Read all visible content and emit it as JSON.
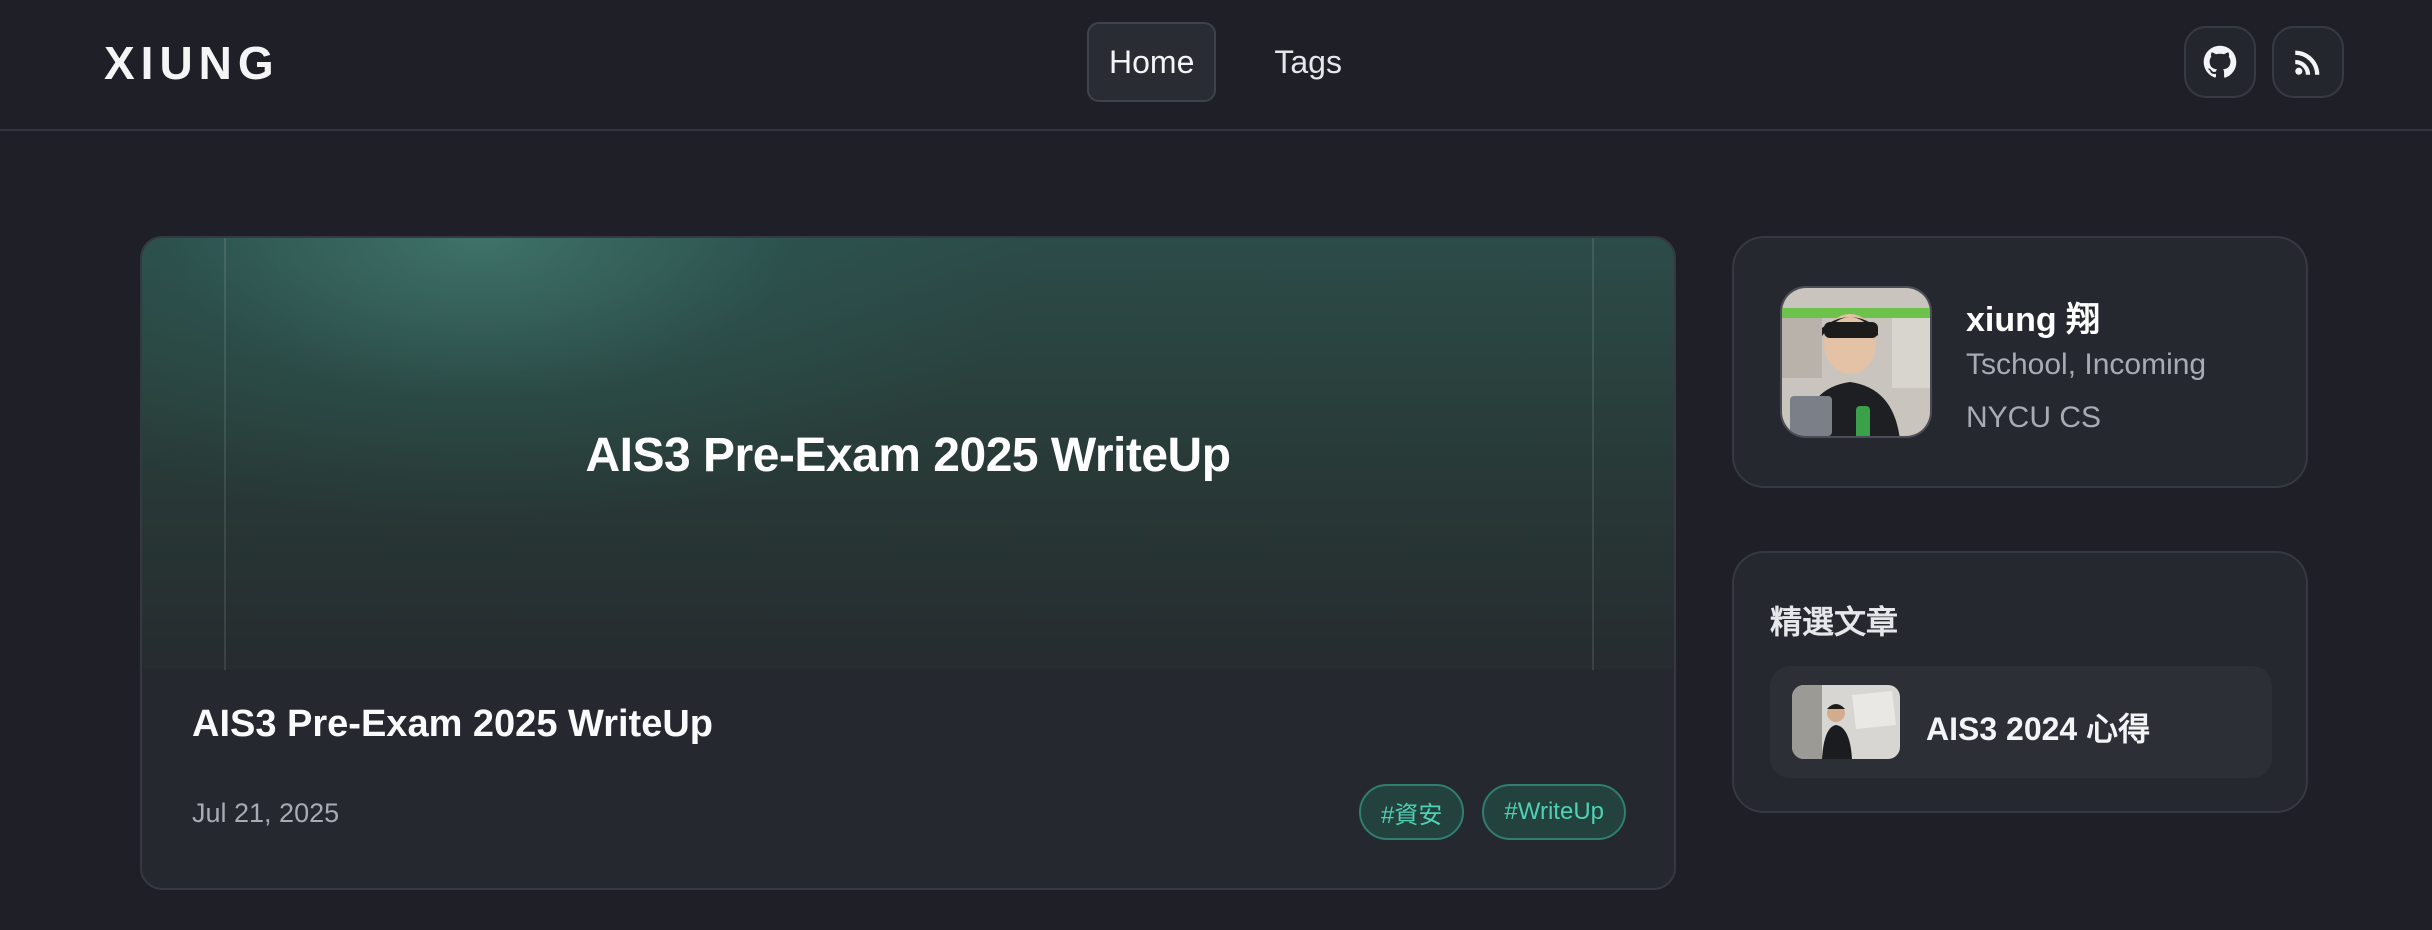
{
  "site": {
    "logo": "XIUNG"
  },
  "nav": {
    "items": [
      {
        "label": "Home",
        "active": true
      },
      {
        "label": "Tags",
        "active": false
      }
    ]
  },
  "header_actions": [
    {
      "icon": "github-icon"
    },
    {
      "icon": "rss-icon"
    }
  ],
  "post": {
    "banner_title": "AIS3 Pre-Exam 2025 WriteUp",
    "title": "AIS3 Pre-Exam 2025 WriteUp",
    "date": "Jul 21, 2025",
    "tags": [
      "#資安",
      "#WriteUp"
    ]
  },
  "profile": {
    "name": "xiung 翔",
    "line1": "Tschool, Incoming",
    "line2": "NYCU CS"
  },
  "featured": {
    "heading": "精選文章",
    "items": [
      {
        "title": "AIS3 2024 心得"
      }
    ]
  },
  "colors": {
    "background": "#1f2027",
    "card": "#262830",
    "accent": "#4fd1b5"
  }
}
